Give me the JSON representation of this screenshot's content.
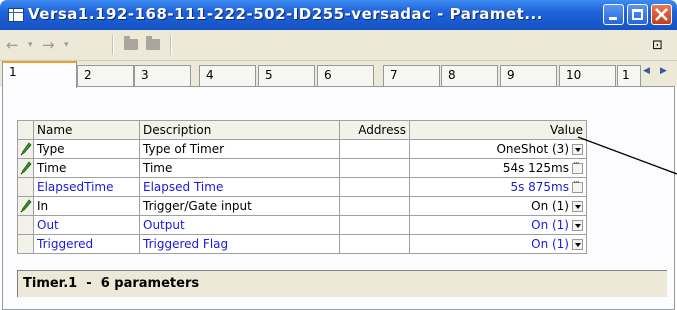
{
  "window": {
    "title": "Versa1.192-168-111-222-502-ID255-versadac - Paramet..."
  },
  "toolbar": {
    "back_icon": "back-arrow-icon",
    "forward_icon": "forward-arrow-icon",
    "pin_icon": "pin-icon"
  },
  "tabs": [
    "1",
    "2",
    "3",
    "4",
    "5",
    "6",
    "7",
    "8",
    "9",
    "10",
    "1"
  ],
  "grid": {
    "headers": {
      "name": "Name",
      "description": "Description",
      "address": "Address",
      "value": "Value"
    },
    "rows": [
      {
        "name": "Type",
        "description": "Type of Timer",
        "address": "",
        "value": "OneShot (3)",
        "editable": true,
        "control": "dropdown",
        "color": "black"
      },
      {
        "name": "Time",
        "description": "Time",
        "address": "",
        "value": "54s 125ms",
        "editable": true,
        "control": "ellipsis",
        "color": "black"
      },
      {
        "name": "ElapsedTime",
        "description": "Elapsed Time",
        "address": "",
        "value": "5s 875ms",
        "editable": false,
        "control": "ellipsis",
        "color": "blue"
      },
      {
        "name": "In",
        "description": "Trigger/Gate input",
        "address": "",
        "value": "On (1)",
        "editable": true,
        "control": "dropdown",
        "color": "black"
      },
      {
        "name": "Out",
        "description": "Output",
        "address": "",
        "value": "On (1)",
        "editable": false,
        "control": "dropdown",
        "color": "blue"
      },
      {
        "name": "Triggered",
        "description": "Triggered Flag",
        "address": "",
        "value": "On (1)",
        "editable": false,
        "control": "dropdown",
        "color": "blue"
      }
    ]
  },
  "status": {
    "text": "Timer.1  -  6 parameters"
  },
  "colors": {
    "readonly_text": "#1a1adc",
    "titlebar": "#1f62d9",
    "active_tab_accent": "#f0a030"
  }
}
